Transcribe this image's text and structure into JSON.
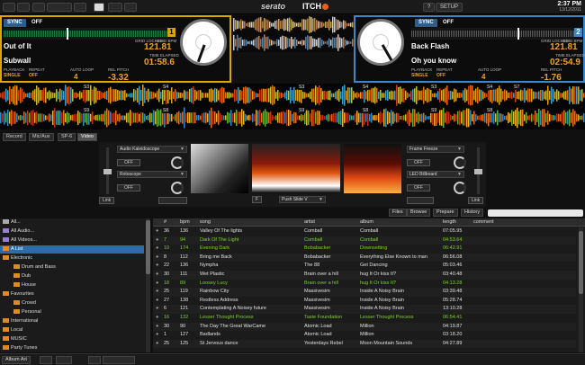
{
  "topbar": {
    "brand": "serato",
    "product": "ITCH",
    "help_label": "?",
    "setup_label": "SETUP",
    "time": "2:37 PM",
    "date": "13/12/2011"
  },
  "deck_left": {
    "number": "1",
    "sync_label": "SYNC",
    "off_label": "OFF",
    "title": "Out of It",
    "artist": "Subwall",
    "bpm": "121.81",
    "grid_label": "GRID LOCKED",
    "grid_bpm_label": "GRID BPM",
    "time_elapsed_label": "TIME ELAPSED",
    "time": "01:58.6",
    "playback_label": "PLAYBACK",
    "playback_value": "SINGLE",
    "repeat_label": "REPEAT",
    "repeat_value": "OFF",
    "auto_loop_label": "AUTO LOOP",
    "auto_loop_value": "4",
    "rel_pitch_label": "REL PITCH",
    "rel_pitch_value": "-3.32",
    "accent": "#d8a800"
  },
  "deck_right": {
    "number": "2",
    "sync_label": "SYNC",
    "off_label": "OFF",
    "title": "Back Flash",
    "artist": "Oh you know",
    "bpm": "121.81",
    "grid_label": "GRID LOCKED",
    "grid_bpm_label": "GRID BPM",
    "time_elapsed_label": "TIME ELAPSED",
    "time": "02:54.9",
    "playback_label": "PLAYBACK",
    "playback_value": "SINGLE",
    "repeat_label": "REPEAT",
    "repeat_value": "OFF",
    "auto_loop_label": "AUTO LOOP",
    "auto_loop_value": "4",
    "rel_pitch_label": "REL PITCH",
    "rel_pitch_value": "-1.76",
    "accent": "#3b87c8"
  },
  "waveform": {
    "cue_top": [
      "S3",
      "S4",
      "S3",
      "S4",
      "S3",
      "S4",
      "S7"
    ],
    "cue_bottom": [
      "S9",
      "S8",
      "S9",
      "S8",
      "S9",
      "S8"
    ]
  },
  "tabs": [
    "Record",
    "Mic/Aux",
    "SP-6",
    "Video"
  ],
  "video": {
    "fx_left_1": "Audio Kaleidoscope",
    "fx_left_2": "Rotoscope",
    "fx_right_1": "Frame Freeze",
    "fx_right_2": "LED Billboard",
    "off_label": "OFF",
    "link_label": "Link",
    "transition": "Push Slide V",
    "f_label": "F"
  },
  "library": {
    "buttons": [
      "Files",
      "Browse",
      "Prepare",
      "History"
    ],
    "crates": [
      {
        "label": "All...",
        "indent": 0,
        "icon": "all",
        "selected": false
      },
      {
        "label": "All Audio...",
        "indent": 0,
        "icon": "audio",
        "selected": false
      },
      {
        "label": "All Videos...",
        "indent": 0,
        "icon": "video",
        "selected": false
      },
      {
        "label": "A List",
        "indent": 0,
        "icon": "crate",
        "selected": true
      },
      {
        "label": "Electronic",
        "indent": 0,
        "icon": "crate",
        "selected": false
      },
      {
        "label": "Drum and Bass",
        "indent": 1,
        "icon": "crate",
        "selected": false
      },
      {
        "label": "Dub",
        "indent": 1,
        "icon": "crate",
        "selected": false
      },
      {
        "label": "House",
        "indent": 1,
        "icon": "crate",
        "selected": false
      },
      {
        "label": "Favourites",
        "indent": 0,
        "icon": "crate",
        "selected": false
      },
      {
        "label": "Crowd",
        "indent": 1,
        "icon": "crate",
        "selected": false
      },
      {
        "label": "Personal",
        "indent": 1,
        "icon": "crate",
        "selected": false
      },
      {
        "label": "International",
        "indent": 0,
        "icon": "crate",
        "selected": false
      },
      {
        "label": "Local",
        "indent": 0,
        "icon": "crate",
        "selected": false
      },
      {
        "label": "MUSIC",
        "indent": 0,
        "icon": "crate",
        "selected": false
      },
      {
        "label": "Party Tunes",
        "indent": 0,
        "icon": "crate",
        "selected": false
      }
    ],
    "columns": [
      "#",
      "bpm",
      "song",
      "artist",
      "album",
      "length",
      "comment"
    ],
    "tracks": [
      {
        "n": "36",
        "bpm": "136",
        "song": "Valley Of The lights",
        "artist": "Comball",
        "album": "Comball",
        "length": "07:05.95",
        "green": false
      },
      {
        "n": "7",
        "bpm": "94",
        "song": "Dark Of The Light",
        "artist": "Comball",
        "album": "Comball",
        "length": "04:53.64",
        "green": true
      },
      {
        "n": "10",
        "bpm": "174",
        "song": "Evening Dark",
        "artist": "Bobabacker",
        "album": "Downsetting",
        "length": "06:42.91",
        "green": true
      },
      {
        "n": "8",
        "bpm": "112",
        "song": "Bring me Back",
        "artist": "Bobabacker",
        "album": "Everything Else Known to man",
        "length": "06:56.08",
        "green": false
      },
      {
        "n": "22",
        "bpm": "136",
        "song": "Nympha",
        "artist": "The 88",
        "album": "Get Dancing",
        "length": "05:03.46",
        "green": false
      },
      {
        "n": "30",
        "bpm": "111",
        "song": "Wet Plastic",
        "artist": "Brain over a hill",
        "album": "hug It Or kiss It?",
        "length": "03:40.48",
        "green": false
      },
      {
        "n": "18",
        "bpm": "89",
        "song": "Loosey Lucy",
        "artist": "Brain over a hill",
        "album": "hug It Or kiss It?",
        "length": "04:13.28",
        "green": true
      },
      {
        "n": "25",
        "bpm": "119",
        "song": "Rainbow City",
        "artist": "Massivesim",
        "album": "Inside A Noisy Brain",
        "length": "03:39.48",
        "green": false
      },
      {
        "n": "27",
        "bpm": "138",
        "song": "Restless Address",
        "artist": "Massivesim",
        "album": "Inside A Noisy Brain",
        "length": "05:28.74",
        "green": false
      },
      {
        "n": "6",
        "bpm": "121",
        "song": "Contemplating A Noisey future",
        "artist": "Massivesim",
        "album": "Inside A Noisy Brain",
        "length": "13:10.28",
        "green": false
      },
      {
        "n": "16",
        "bpm": "132",
        "song": "Lesser Thought Process",
        "artist": "Taste Foundation",
        "album": "Lesser Thought Process",
        "length": "06:54.41",
        "green": true
      },
      {
        "n": "30",
        "bpm": "90",
        "song": "The Day The Great WarCame",
        "artist": "Atomic Load",
        "album": "Million",
        "length": "04:19.87",
        "green": false
      },
      {
        "n": "1",
        "bpm": "127",
        "song": "Badlands",
        "artist": "Atomic Load",
        "album": "Million",
        "length": "03:18.20",
        "green": false
      },
      {
        "n": "25",
        "bpm": "125",
        "song": "St Jervous dance",
        "artist": "Yesterdays Rebel",
        "album": "Moon Mountain Sounds",
        "length": "04:27.89",
        "green": false
      }
    ]
  },
  "bottombar": {
    "album_art_label": "Album Art"
  },
  "colors": {
    "accent_left": "#d8a800",
    "accent_right": "#3b87c8",
    "highlight_green": "#7ed321",
    "selection_blue": "#2d6aa8"
  }
}
